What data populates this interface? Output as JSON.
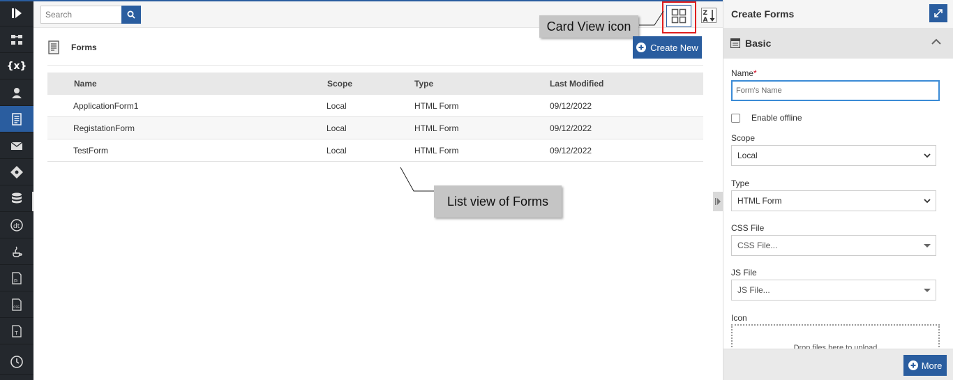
{
  "toolbar": {
    "search_placeholder": "Search",
    "card_view_icon": "card-view-icon",
    "sort_icon": "sort-az-icon"
  },
  "annotations": {
    "card_view": "Card View icon",
    "list_view": "List view of Forms"
  },
  "forms": {
    "title": "Forms",
    "create_new": "Create New"
  },
  "table": {
    "columns": [
      "Name",
      "Scope",
      "Type",
      "Last Modified"
    ],
    "rows": [
      [
        "ApplicationForm1",
        "Local",
        "HTML Form",
        "09/12/2022"
      ],
      [
        "RegistationForm",
        "Local",
        "HTML Form",
        "09/12/2022"
      ],
      [
        "TestForm",
        "Local",
        "HTML Form",
        "09/12/2022"
      ]
    ]
  },
  "panel": {
    "title": "Create Forms",
    "section": "Basic",
    "name_label": "Name",
    "required_mark": "*",
    "name_placeholder": "Form's Name",
    "enable_offline": "Enable offline",
    "scope_label": "Scope",
    "scope_value": "Local",
    "type_label": "Type",
    "type_value": "HTML Form",
    "css_label": "CSS File",
    "css_value": "CSS File...",
    "js_label": "JS File",
    "js_value": "JS File...",
    "icon_label": "Icon",
    "drop_text": "Drop files here to upload",
    "more": "More"
  },
  "colors": {
    "accent": "#2a5d9f",
    "rail": "#24282d",
    "highlight": "#e01e1e"
  }
}
